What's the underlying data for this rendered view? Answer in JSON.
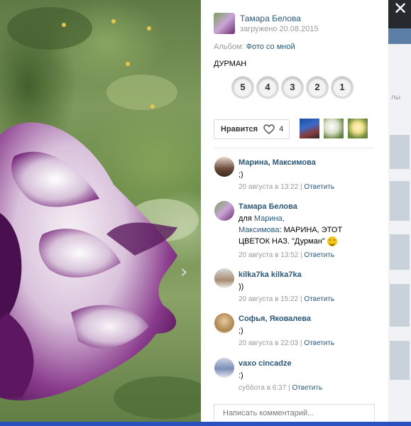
{
  "window": {
    "close_label": "✕"
  },
  "photo": {
    "alt": "flower-photo"
  },
  "author": {
    "name": "Тамара Белова",
    "uploaded": "загружено 20.08.2015"
  },
  "album": {
    "prefix": "Альбом:",
    "name": "Фото со мной"
  },
  "description": "ДУРМАН",
  "rating": {
    "options": [
      "5",
      "4",
      "3",
      "2",
      "1"
    ]
  },
  "like": {
    "label": "Нравится",
    "count": "4"
  },
  "comments": [
    {
      "name": "Марина, Максимова",
      "text": ";)",
      "time": "20 августа в 13:22",
      "reply": "Ответить"
    },
    {
      "name": "Тамара Белова",
      "to_prefix": "для",
      "to": "Марина,",
      "to2": "Максимова",
      "text": ": МАРИНА, ЭТОТ ЦВЕТОК НАЗ. \"Дурман\"",
      "time": "20 августа в 13:52",
      "reply": "Ответить"
    },
    {
      "name": "kilka7ka kilka7ka",
      "text": "))",
      "time": "20 августа в 15:22",
      "reply": "Ответить"
    },
    {
      "name": "Софья, Яковалева",
      "text": ";)",
      "time": "20 августа в 22:03",
      "reply": "Ответить"
    },
    {
      "name": "vaxo cincadze",
      "text": ":)",
      "time": "суббота в 6:37",
      "reply": "Ответить"
    }
  ],
  "comment_input": {
    "placeholder": "Написать комментарий..."
  },
  "right_strip": {
    "partial_text": "лы"
  },
  "colors": {
    "link": "#2b587a",
    "meta": "#999999",
    "panel_bg": "#ffffff",
    "backdrop": "#26292d"
  }
}
